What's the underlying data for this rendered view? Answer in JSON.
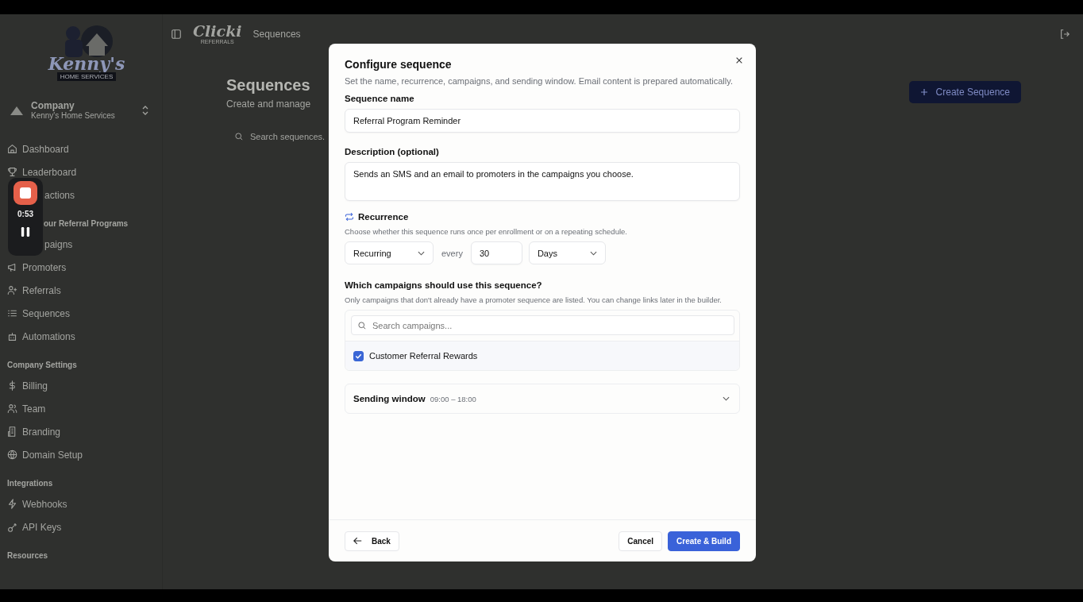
{
  "sidebar": {
    "logo": {
      "name": "Kenny's",
      "tagline": "HOME SERVICES"
    },
    "company": {
      "label": "Company",
      "name": "Kenny's Home Services"
    },
    "sections": [
      {
        "items": [
          {
            "label": "Dashboard",
            "covered": false
          },
          {
            "label": "Leaderboard",
            "covered": false
          },
          {
            "label": "actions",
            "covered": true
          }
        ]
      },
      {
        "heading": "our Referral Programs",
        "heading_covered": true,
        "items": [
          {
            "label": "paigns",
            "covered": true
          },
          {
            "label": "Promoters",
            "covered": false
          },
          {
            "label": "Referrals",
            "covered": false
          },
          {
            "label": "Sequences",
            "covered": false
          },
          {
            "label": "Automations",
            "covered": false
          }
        ]
      },
      {
        "heading": "Company Settings",
        "items": [
          {
            "label": "Billing",
            "covered": false
          },
          {
            "label": "Team",
            "covered": false
          },
          {
            "label": "Branding",
            "covered": false
          },
          {
            "label": "Domain Setup",
            "covered": false
          }
        ]
      },
      {
        "heading": "Integrations",
        "items": [
          {
            "label": "Webhooks",
            "covered": false
          },
          {
            "label": "API Keys",
            "covered": false
          }
        ]
      },
      {
        "heading": "Resources"
      }
    ]
  },
  "recorder": {
    "time": "0:53"
  },
  "header": {
    "brand": "Clicki",
    "brand_sub": "REFERRALS",
    "breadcrumb": "Sequences"
  },
  "page": {
    "title": "Sequences",
    "subtitle": "Create and manage",
    "search_placeholder": "Search sequences.",
    "create_button": "Create Sequence"
  },
  "dialog": {
    "title": "Configure sequence",
    "description": "Set the name, recurrence, campaigns, and sending window. Email content is prepared automatically.",
    "name_label": "Sequence name",
    "name_value": "Referral Program Reminder",
    "description_label": "Description (optional)",
    "description_value": "Sends an SMS and an email to promoters in the campaigns you choose.",
    "recurrence": {
      "label": "Recurrence",
      "help": "Choose whether this sequence runs once per enrollment or on a repeating schedule.",
      "mode": "Recurring",
      "every": "every",
      "interval": "30",
      "unit": "Days"
    },
    "campaigns": {
      "label": "Which campaigns should use this sequence?",
      "help": "Only campaigns that don't already have a promoter sequence are listed. You can change links later in the builder.",
      "search_placeholder": "Search campaigns...",
      "items": [
        {
          "label": "Customer Referral Rewards",
          "checked": true
        }
      ]
    },
    "sending_window": {
      "label": "Sending window",
      "value": "09:00 – 18:00",
      "expanded": false
    },
    "buttons": {
      "back": "Back",
      "cancel": "Cancel",
      "submit": "Create & Build"
    }
  }
}
